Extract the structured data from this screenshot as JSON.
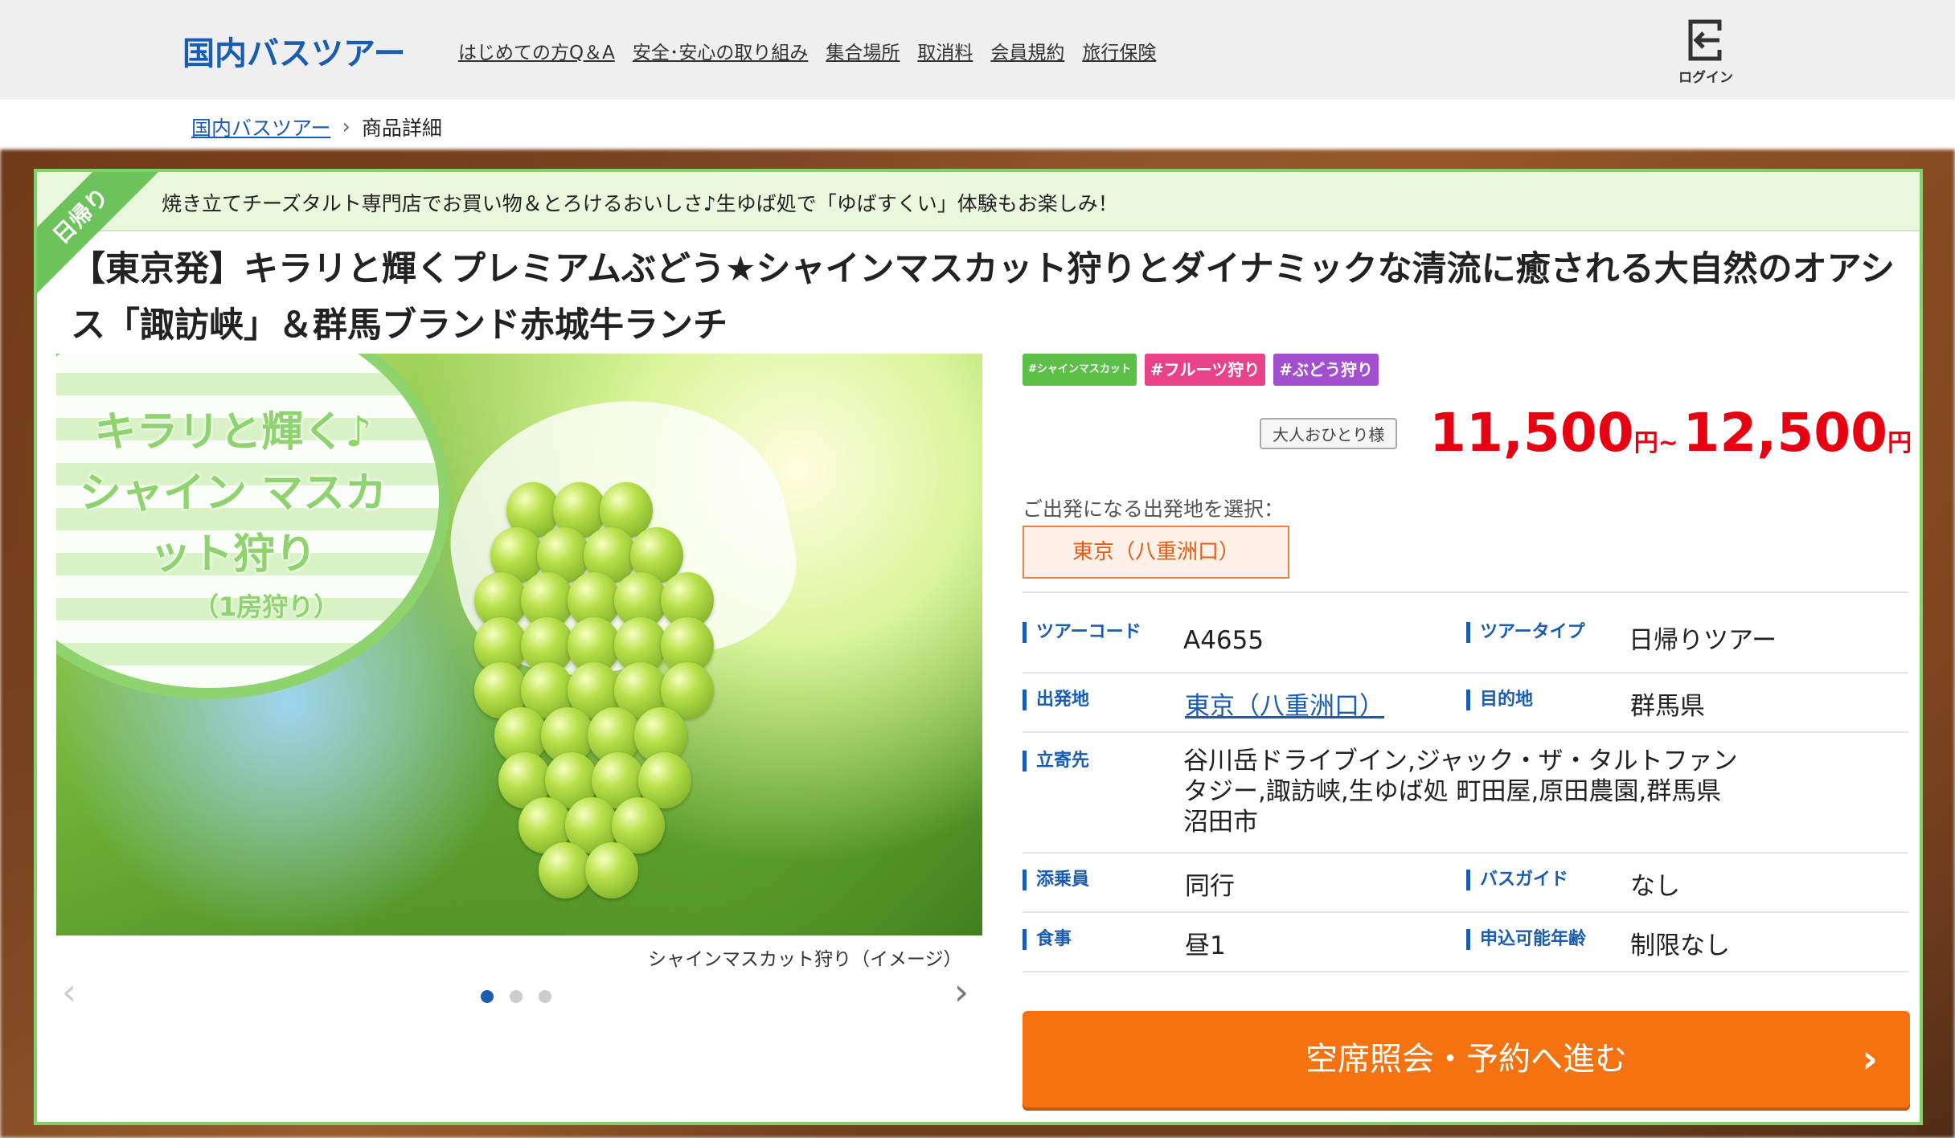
{
  "header": {
    "site_title": "国内バスツアー",
    "nav": [
      "はじめての方Q＆A",
      "安全･安心の取り組み",
      "集合場所",
      "取消料",
      "会員規約",
      "旅行保険"
    ],
    "login_label": "ログイン"
  },
  "breadcrumb": {
    "link": "国内バスツアー",
    "current": "商品詳細"
  },
  "card": {
    "corner_badge": "日帰り",
    "banner_text": "焼き立てチーズタルト専門店でお買い物＆とろけるおいしさ♪生ゆば処で「ゆばすくい」体験もお楽しみ！",
    "title": "【東京発】キラリと輝くプレミアムぶどう★シャインマスカット狩りとダイナミックな清流に癒される大自然のオアシス「諏訪峡」＆群馬ブランド赤城牛ランチ"
  },
  "gallery": {
    "overlay_text": "キラリと輝く♪ シャイン マスカット狩り",
    "overlay_sub": "（1房狩り）",
    "caption": "シャインマスカット狩り（イメージ）",
    "prev_label": "‹",
    "next_label": "›"
  },
  "tags": [
    {
      "label": "#シャインマスカット",
      "color": "#5cbf4a"
    },
    {
      "label": "#フルーツ狩り",
      "color": "#e8428a"
    },
    {
      "label": "#ぶどう狩り",
      "color": "#a24fd0"
    }
  ],
  "price": {
    "label": "大人おひとり様",
    "min": "11,500",
    "min_unit": "円~",
    "max": "12,500",
    "max_unit": "円"
  },
  "departure": {
    "label": "ご出発になる出発地を選択：",
    "selected": "東京（八重洲口）"
  },
  "info": {
    "tour_code_label": "ツアーコード",
    "tour_code": "A4655",
    "tour_type_label": "ツアータイプ",
    "tour_type": "日帰りツアー",
    "origin_label": "出発地",
    "origin": "東京（八重洲口）",
    "destination_label": "目的地",
    "destination": "群馬県",
    "stops_label": "立寄先",
    "stops": "谷川岳ドライブイン,ジャック・ザ・タルトファンタジー,諏訪峡,生ゆば処 町田屋,原田農園,群馬県沼田市",
    "escort_label": "添乗員",
    "escort": "同行",
    "guide_label": "バスガイド",
    "guide": "なし",
    "meals_label": "食事",
    "meals": "昼1",
    "age_label": "申込可能年齢",
    "age": "制限なし"
  },
  "reserve_button": "空席照会・予約へ進む",
  "colors": {
    "brand_blue": "#1a5cb0",
    "accent_green": "#7ed36a",
    "price_red": "#e60012",
    "cta_orange": "#f47310"
  }
}
